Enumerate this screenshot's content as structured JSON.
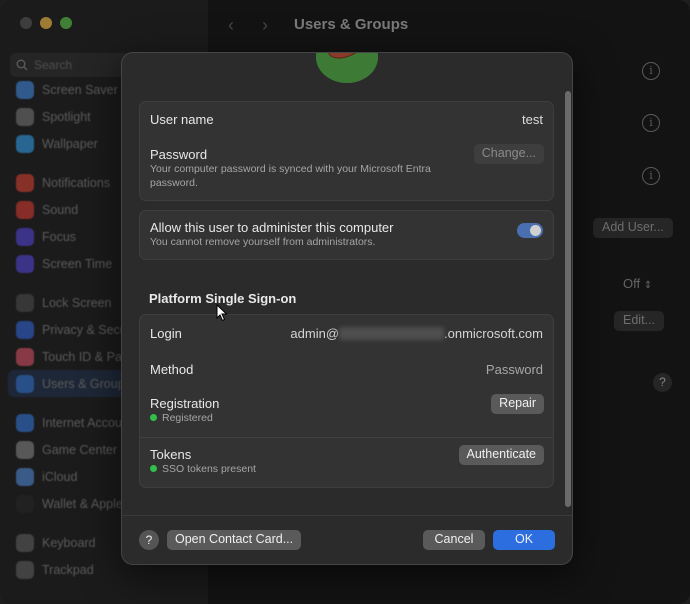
{
  "window": {
    "title": "Users & Groups"
  },
  "sidebar": {
    "search_placeholder": "Search",
    "items": [
      {
        "label": "Screen Saver",
        "color": "#4a8ad6"
      },
      {
        "label": "Spotlight",
        "color": "#7a7a7a"
      },
      {
        "label": "Wallpaper",
        "color": "#3e9be0"
      },
      {
        "label": "Notifications",
        "color": "#d04a3e"
      },
      {
        "label": "Sound",
        "color": "#d0453e"
      },
      {
        "label": "Focus",
        "color": "#5b4fd0"
      },
      {
        "label": "Screen Time",
        "color": "#5b4fd0"
      },
      {
        "label": "Lock Screen",
        "color": "#555555"
      },
      {
        "label": "Privacy & Security",
        "color": "#3e6ad0"
      },
      {
        "label": "Touch ID & Password",
        "color": "#d05a6a"
      },
      {
        "label": "Users & Groups",
        "color": "#3e7ad0"
      },
      {
        "label": "Internet Accounts",
        "color": "#3e7ad0"
      },
      {
        "label": "Game Center",
        "color": "#888888"
      },
      {
        "label": "iCloud",
        "color": "#5a8ad0"
      },
      {
        "label": "Wallet & Apple Pay",
        "color": "#333333"
      },
      {
        "label": "Keyboard",
        "color": "#666666"
      },
      {
        "label": "Trackpad",
        "color": "#666666"
      }
    ]
  },
  "background": {
    "add_user_label": "Add User...",
    "off_label": "Off",
    "edit_label": "Edit...",
    "help_label": "?"
  },
  "sheet": {
    "account": {
      "username_label": "User name",
      "username_value": "test",
      "password_label": "Password",
      "password_note": "Your computer password is synced with your Microsoft Entra password.",
      "change_button": "Change..."
    },
    "admin": {
      "label": "Allow this user to administer this computer",
      "note": "You cannot remove yourself from administrators.",
      "enabled": true
    },
    "psso": {
      "section_title": "Platform Single Sign-on",
      "login_label": "Login",
      "login_prefix": "admin@",
      "login_suffix": ".onmicrosoft.com",
      "method_label": "Method",
      "method_value": "Password",
      "registration_label": "Registration",
      "registration_status": "Registered",
      "repair_button": "Repair",
      "tokens_label": "Tokens",
      "tokens_status": "SSO tokens present",
      "authenticate_button": "Authenticate"
    },
    "footer": {
      "help_label": "?",
      "contact_button": "Open Contact Card...",
      "cancel_button": "Cancel",
      "ok_button": "OK"
    }
  }
}
